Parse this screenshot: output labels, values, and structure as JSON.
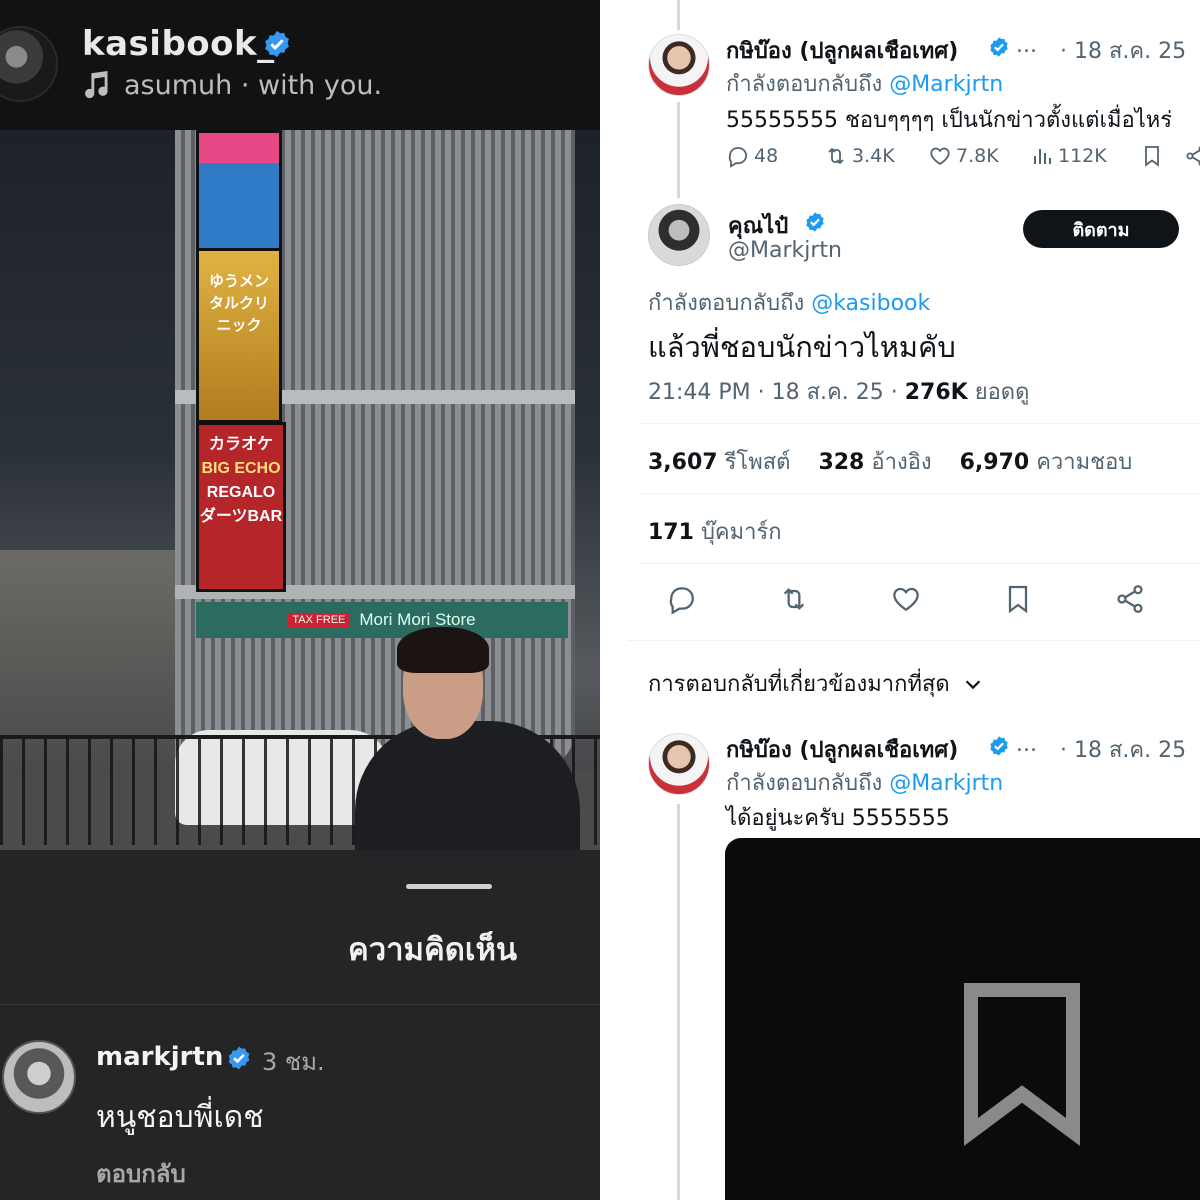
{
  "instagram": {
    "username": "kasibook_",
    "music": "asumuh · with you.",
    "sheet_title": "ความคิดเห็น",
    "signs": {
      "yellow_text": "ゆうメンタルクリニック",
      "red_line1": "カラオケ",
      "red_line2": "BIG ECHO",
      "red_line3": "REGALO",
      "red_line4": "ダーツBAR",
      "store": "Mori Mori Store",
      "tax_free": "TAX FREE"
    },
    "comment": {
      "username": "markjrtn",
      "time": "3 ชม.",
      "text": "หนูชอบพี่เดช",
      "reply_label": "ตอบกลับ"
    }
  },
  "twitter": {
    "colors": {
      "accent": "#1d9bf0",
      "text": "#0f1419",
      "muted": "#536471"
    },
    "parent_tweet": {
      "name": "กษิบ๊อง (ปลูกผลเชือเทศ)",
      "ellipsis": "...",
      "date": "· 18 ส.ค. 25",
      "replying_prefix": "กำลังตอบกลับถึง",
      "replying_to": "@Markjrtn",
      "text": "55555555 ชอบๆๆๆๆ เป็นนักข่าวตั้งแต่เมื่อไหร่",
      "replies": "48",
      "retweets": "3.4K",
      "likes": "7.8K",
      "views": "112K"
    },
    "main_tweet": {
      "name": "คุณไป๋",
      "handle": "@Markjrtn",
      "follow_label": "ติดตาม",
      "replying_prefix": "กำลังตอบกลับถึง",
      "replying_to": "@kasibook",
      "text": "แล้วพี่ชอบนักข่าวไหมคับ",
      "timestamp": "21:44 PM · 18 ส.ค. 25 ·",
      "views_count": "276K",
      "views_label": "ยอดดู",
      "retweets_count": "3,607",
      "retweets_label": "รีโพสต์",
      "quotes_count": "328",
      "quotes_label": "อ้างอิง",
      "likes_count": "6,970",
      "likes_label": "ความชอบ",
      "bookmarks_count": "171",
      "bookmarks_label": "บุ๊คมาร์ก"
    },
    "sort_label": "การตอบกลับที่เกี่ยวข้องมากที่สุด",
    "reply_tweet": {
      "name": "กษิบ๊อง (ปลูกผลเชือเทศ)",
      "ellipsis": "...",
      "date": "· 18 ส.ค. 25",
      "replying_prefix": "กำลังตอบกลับถึง",
      "replying_to": "@Markjrtn",
      "text": "ได้อยู่นะครับ 5555555"
    }
  }
}
